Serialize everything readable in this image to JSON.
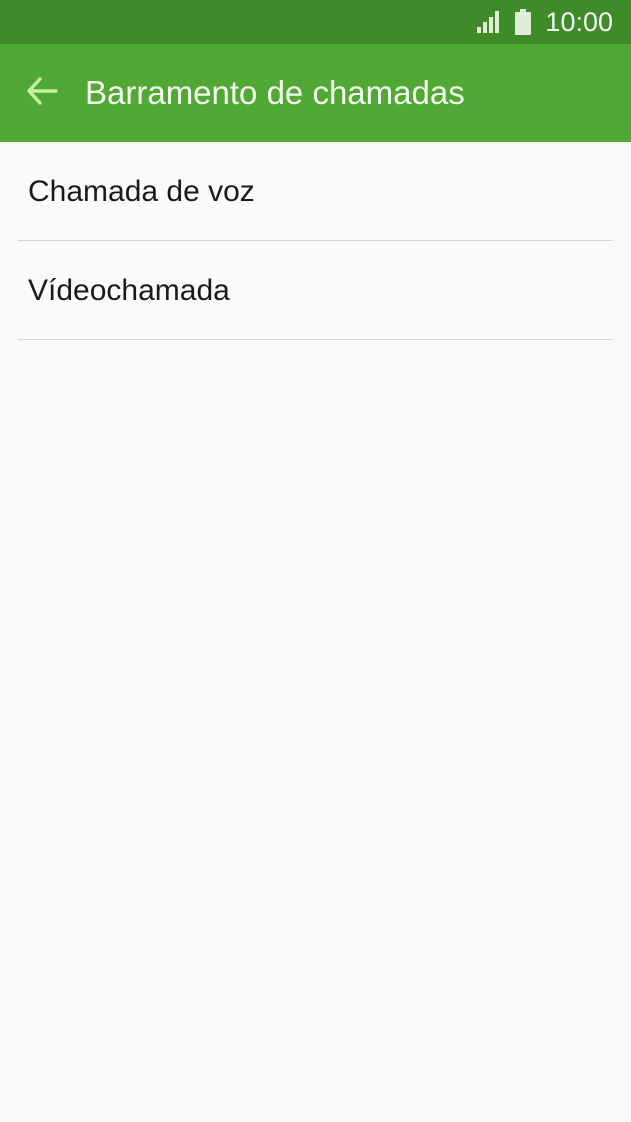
{
  "status_bar": {
    "time": "10:00",
    "icons": [
      "signal-icon",
      "battery-icon"
    ]
  },
  "app_bar": {
    "title": "Barramento de chamadas",
    "back_icon": "arrow-left-icon"
  },
  "menu": {
    "items": [
      {
        "label": "Chamada de voz"
      },
      {
        "label": "Vídeochamada"
      }
    ]
  },
  "colors": {
    "status_bar": "#3f8a29",
    "app_bar": "#51a834",
    "back_arrow": "#c6f0a2",
    "background": "#fafafa",
    "divider": "#d6d6d6"
  }
}
